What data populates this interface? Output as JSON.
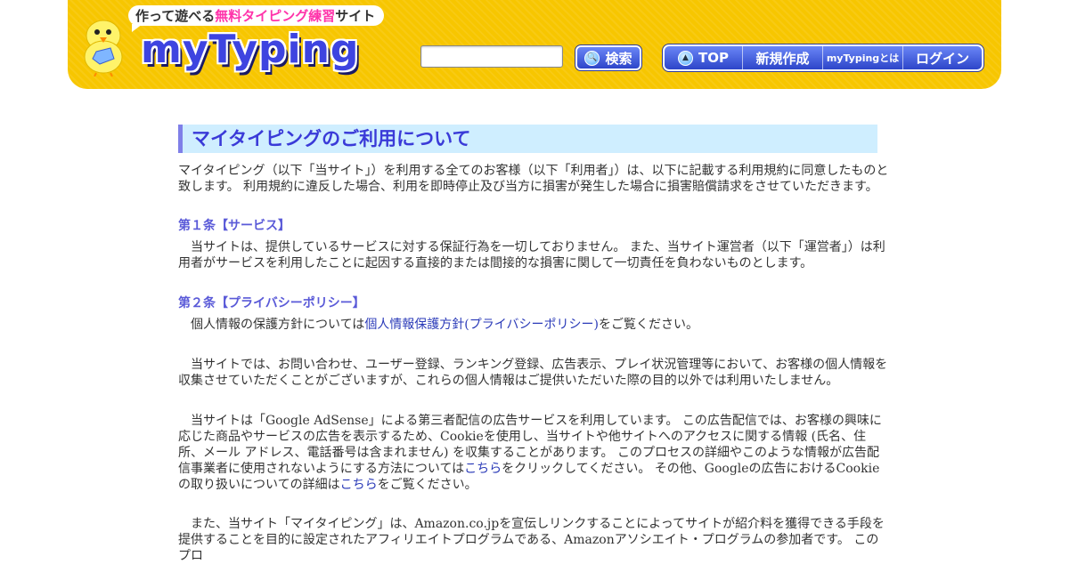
{
  "header": {
    "tagline_prefix": "作って遊べる",
    "tagline_highlight": "無料タイピング練習",
    "tagline_suffix": "サイト",
    "logo_text": "myTyping",
    "search_placeholder": "",
    "search_button_label": "検索",
    "nav": [
      "TOP",
      "新規作成",
      "myTypingとは",
      "ログイン"
    ]
  },
  "colors": {
    "header_bg": "#f7c600",
    "accent_blue": "#3a3ad8",
    "title_bg": "#cfeeff",
    "highlight_pink": "#ff33aa"
  },
  "content": {
    "page_title": "マイタイピングのご利用について",
    "intro": "マイタイピング（以下「当サイト」）を利用する全てのお客様（以下「利用者」）は、以下に記載する利用規約に同意したものと致します。 利用規約に違反した場合、利用を即時停止及び当方に損害が発生した場合に損害賠償請求をさせていただきます。",
    "article1_title": "第１条【サービス】",
    "article1_text": "当サイトは、提供しているサービスに対する保証行為を一切しておりません。 また、当サイト運営者（以下「運営者」）は利用者がサービスを利用したことに起因する直接的または間接的な損害に関して一切責任を負わないものとします。",
    "article2_title": "第２条【プライバシーポリシー】",
    "privacy_pre": "個人情報の保護方針については",
    "privacy_link": "個人情報保護方針(プライバシーポリシー)",
    "privacy_post": "をご覧ください。",
    "p2": "当サイトでは、お問い合わせ、ユーザー登録、ランキング登録、広告表示、プレイ状況管理等において、お客様の個人情報を収集させていただくことがございますが、これらの個人情報はご提供いただいた際の目的以外では利用いたしません。",
    "p3_a": "当サイトは「Google AdSense」による第三者配信の広告サービスを利用しています。 この広告配信では、お客様の興味に応じた商品やサービスの広告を表示するため、Cookieを使用し、当サイトや他サイトへのアクセスに関する情報 (氏名、住所、メール アドレス、電話番号は含まれません) を収集することがあります。 このプロセスの詳細やこのような情報が広告配信事業者に使用されないようにする方法については",
    "p3_link1": "こちら",
    "p3_b": "をクリックしてください。 その他、Googleの広告におけるCookieの取り扱いについての詳細は",
    "p3_link2": "こちら",
    "p3_c": "をご覧ください。",
    "p4": "また、当サイト「マイタイピング」は、Amazon.co.jpを宣伝しリンクすることによってサイトが紹介料を獲得できる手段を提供することを目的に設定されたアフィリエイトプログラムである、Amazonアソシエイト・プログラムの参加者です。 このプロ"
  }
}
